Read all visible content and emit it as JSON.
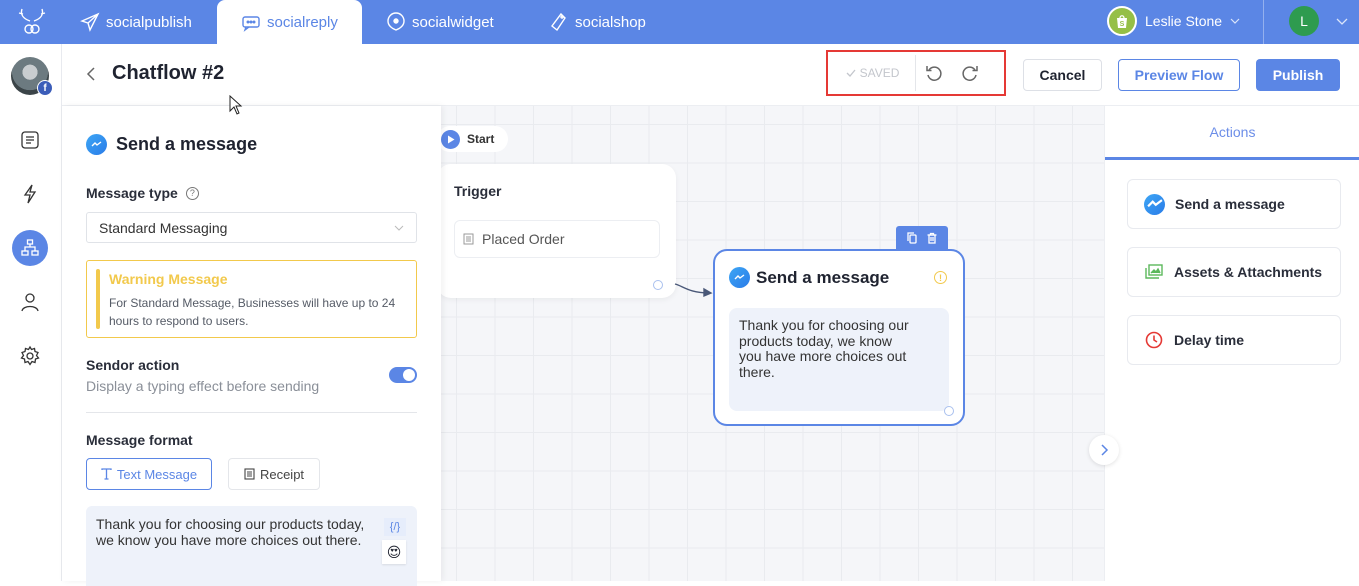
{
  "topnav": {
    "tabs": [
      {
        "label": "socialpublish",
        "icon": "paper-plane-icon",
        "active": false
      },
      {
        "label": "socialreply",
        "icon": "chat-bubble-icon",
        "active": true
      },
      {
        "label": "socialwidget",
        "icon": "location-pin-icon",
        "active": false
      },
      {
        "label": "socialshop",
        "icon": "tag-icon",
        "active": false
      }
    ],
    "store_name": "Leslie Stone",
    "user_initial": "L",
    "colors": {
      "primary": "#5b86e5",
      "shopify": "#95bf47",
      "avatar": "#2e9b4f"
    }
  },
  "header": {
    "title": "Chatflow #2",
    "saved_label": "SAVED",
    "cancel_label": "Cancel",
    "preview_label": "Preview Flow",
    "publish_label": "Publish"
  },
  "rail": {
    "items": [
      {
        "name": "content-icon",
        "active": false
      },
      {
        "name": "lightning-icon",
        "active": false
      },
      {
        "name": "flow-diagram-icon",
        "active": true
      },
      {
        "name": "user-icon",
        "active": false
      },
      {
        "name": "settings-gear-icon",
        "active": false
      }
    ],
    "badge": "f"
  },
  "panel": {
    "title": "Send a message",
    "message_type_label": "Message type",
    "help_glyph": "?",
    "message_type_value": "Standard Messaging",
    "warning_title": "Warning Message",
    "warning_text": "For Standard Message, Businesses will have up to 24 hours to respond to users.",
    "sendor_title": "Sendor action",
    "sendor_sub": "Display a typing effect before sending",
    "sendor_enabled": true,
    "format_label": "Message format",
    "format_options": [
      {
        "label": "Text Message",
        "selected": true
      },
      {
        "label": "Receipt",
        "selected": false
      }
    ],
    "message_text": "Thank you for choosing our products today, we know you have more choices out there.",
    "variable_glyph": "{/}",
    "emoji_glyph": "😍"
  },
  "canvas": {
    "start_label": "Start",
    "trigger_title": "Trigger",
    "trigger_item": "Placed Order",
    "node_title": "Send a message",
    "node_alert_glyph": "!",
    "node_text": "Thank you for choosing our products today, we know you have more choices out there."
  },
  "actions": {
    "tab_label": "Actions",
    "items": [
      {
        "label": "Send a message",
        "icon": "messenger-icon",
        "color": "#2a7ce8"
      },
      {
        "label": "Assets & Attachments",
        "icon": "images-icon",
        "color": "#5cb85c"
      },
      {
        "label": "Delay time",
        "icon": "clock-icon",
        "color": "#e53935"
      }
    ]
  }
}
